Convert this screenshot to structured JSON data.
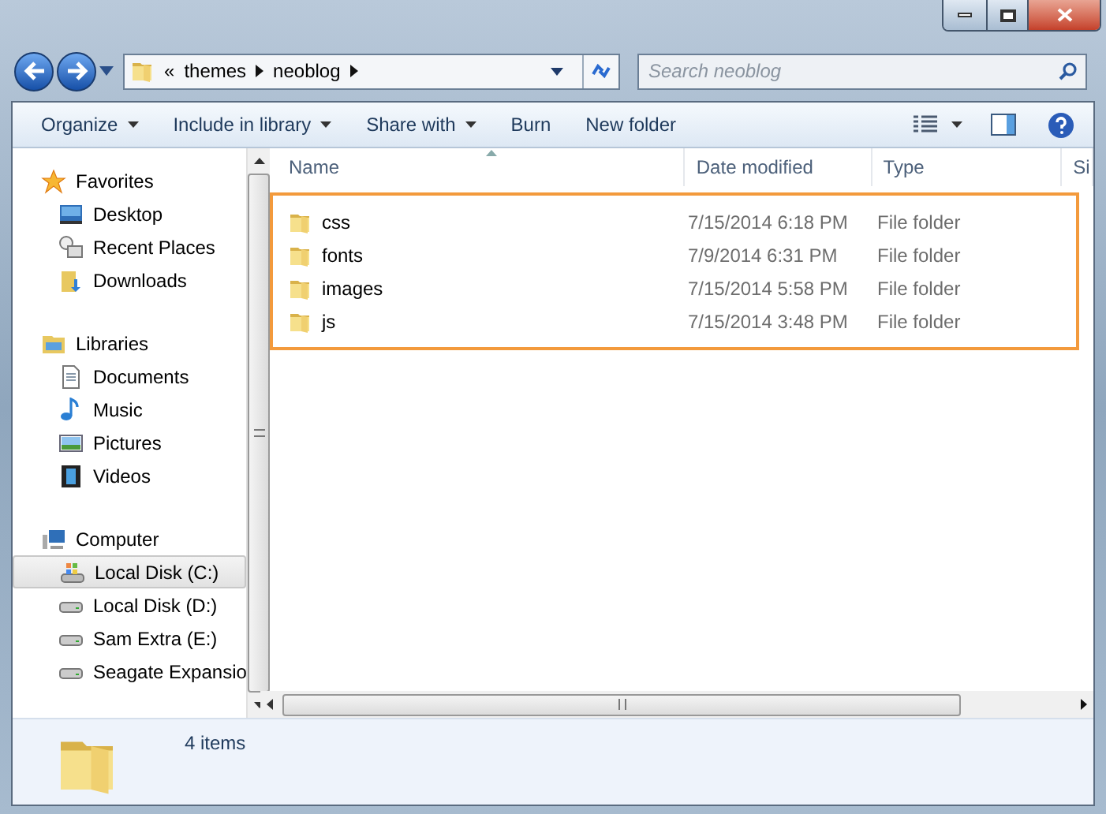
{
  "address": {
    "overflow": "«",
    "crumbs": [
      "themes",
      "neoblog"
    ]
  },
  "search": {
    "placeholder": "Search neoblog"
  },
  "toolbar": [
    {
      "label": "Organize",
      "menu": true
    },
    {
      "label": "Include in library",
      "menu": true
    },
    {
      "label": "Share with",
      "menu": true
    },
    {
      "label": "Burn",
      "menu": false
    },
    {
      "label": "New folder",
      "menu": false
    }
  ],
  "sidebar": {
    "groups": [
      {
        "label": "Favorites",
        "kind": "star",
        "children": [
          {
            "label": "Desktop",
            "kind": "desktop",
            "selected": false
          },
          {
            "label": "Recent Places",
            "kind": "recent",
            "selected": false
          },
          {
            "label": "Downloads",
            "kind": "downloads",
            "selected": false
          }
        ]
      },
      {
        "label": "Libraries",
        "kind": "library",
        "children": [
          {
            "label": "Documents",
            "kind": "document",
            "selected": false
          },
          {
            "label": "Music",
            "kind": "music",
            "selected": false
          },
          {
            "label": "Pictures",
            "kind": "pictures",
            "selected": false
          },
          {
            "label": "Videos",
            "kind": "videos",
            "selected": false
          }
        ]
      },
      {
        "label": "Computer",
        "kind": "computer",
        "children": [
          {
            "label": "Local Disk (C:)",
            "kind": "system-drive",
            "selected": true
          },
          {
            "label": "Local Disk (D:)",
            "kind": "drive",
            "selected": false
          },
          {
            "label": "Sam Extra (E:)",
            "kind": "drive",
            "selected": false
          },
          {
            "label": "Seagate Expansio",
            "kind": "drive",
            "selected": false
          }
        ]
      }
    ]
  },
  "table": {
    "columns": [
      "Name",
      "Date modified",
      "Type",
      "Si"
    ],
    "rows": [
      [
        "css",
        "7/15/2014 6:18 PM",
        "File folder"
      ],
      [
        "fonts",
        "7/9/2014 6:31 PM",
        "File folder"
      ],
      [
        "images",
        "7/15/2014 5:58 PM",
        "File folder"
      ],
      [
        "js",
        "7/15/2014 3:48 PM",
        "File folder"
      ]
    ]
  },
  "status_bar": {
    "count": "4 items"
  }
}
